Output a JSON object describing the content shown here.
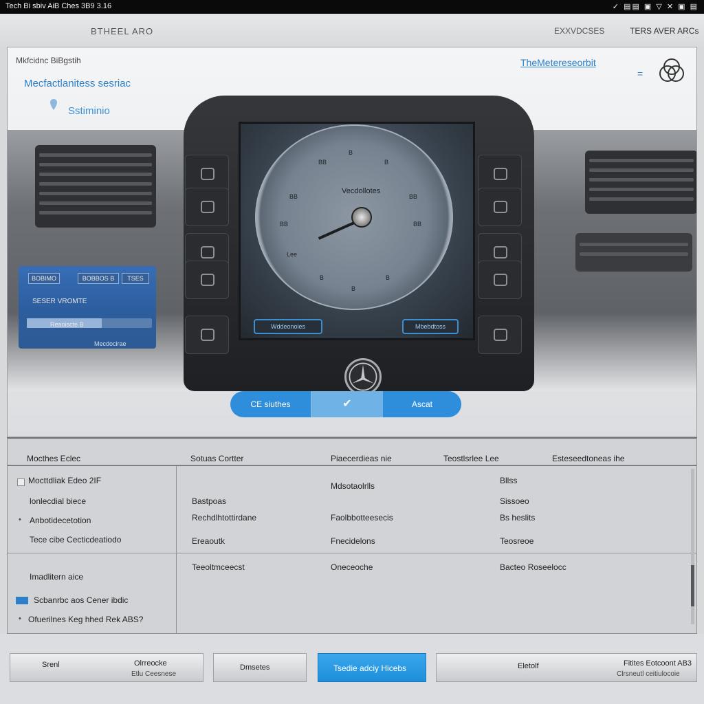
{
  "topbar": {
    "title": "Tech Bi sbiv AiB Ches 3B9 3.16",
    "status": "✓ ▤▤ ▣ ▽ ✕ ▣ ▤"
  },
  "header": {
    "brand": "BTHEEL ARO",
    "nav": [
      "EXXVDCSES",
      "TERS AVER ARCs"
    ]
  },
  "main": {
    "breadcrumb": "Mkfcidnc BiBgstih",
    "headline": "Mecfactlanitess sesriac",
    "subtitle": "Sstiminio",
    "right_title": "TheMetereseorbit",
    "menu_icon": "=",
    "dial": {
      "label": "Vecdollotes",
      "marks": [
        "B",
        "B",
        "BB",
        "BB",
        "BB",
        "BB",
        "Lee",
        "BB",
        "B",
        "B",
        "B"
      ],
      "left_button": "Wddeonoies",
      "right_button": "Mbebdtoss"
    },
    "info_card": {
      "tags": [
        "BOBIMO",
        "BOBBOS B",
        "TSES"
      ],
      "line1": "SESER VROMTE",
      "line2": "Reaoiscte B",
      "line3": "Mecdocirae"
    },
    "segment": {
      "left": "CE siuthes",
      "middle": "✔",
      "right": "Ascat"
    }
  },
  "table": {
    "headers": [
      "Mocthes Eclec",
      "Sotuas Cortter",
      "Piaecerdieas nie",
      "Teostlsrlee Lee",
      "Esteseedtoneas ihe"
    ],
    "left_panel": [
      "Mocttdliak Edeo 2IF",
      "lonlecdial biece",
      "Anbotidecetotion",
      "Tece cibe Cecticdeatiodo",
      "Imadlitern aice",
      "Scbanrbc aos Cener ibdic",
      "Ofuerilnes Keg hhed Rek ABS?"
    ],
    "rows": [
      [
        "",
        "Mdsotaolrlls",
        "Bllss"
      ],
      [
        "Bastpoas",
        "",
        "Sissoeo"
      ],
      [
        "Rechdlhtottirdane",
        "Faolbbotteesecis",
        "Bs heslits"
      ],
      [
        "Ereaoutk",
        "Fnecidelons",
        "Teosreoe"
      ],
      [
        "Teeoltmceecst",
        "Oneceoche",
        "Bacteo Roseelocc"
      ]
    ]
  },
  "footer": {
    "buttons": [
      {
        "a": "Srenl",
        "b": "Olrreocke",
        "c": "Etlu Ceesnese"
      },
      {
        "a": "Dmsetes"
      },
      {
        "a": "Tsedie adciy Hicebs"
      },
      {
        "a": "Eletolf",
        "b": "Fitites Eotcoont AB3",
        "c": "Clrsneutl ceitiulocoie"
      }
    ]
  }
}
